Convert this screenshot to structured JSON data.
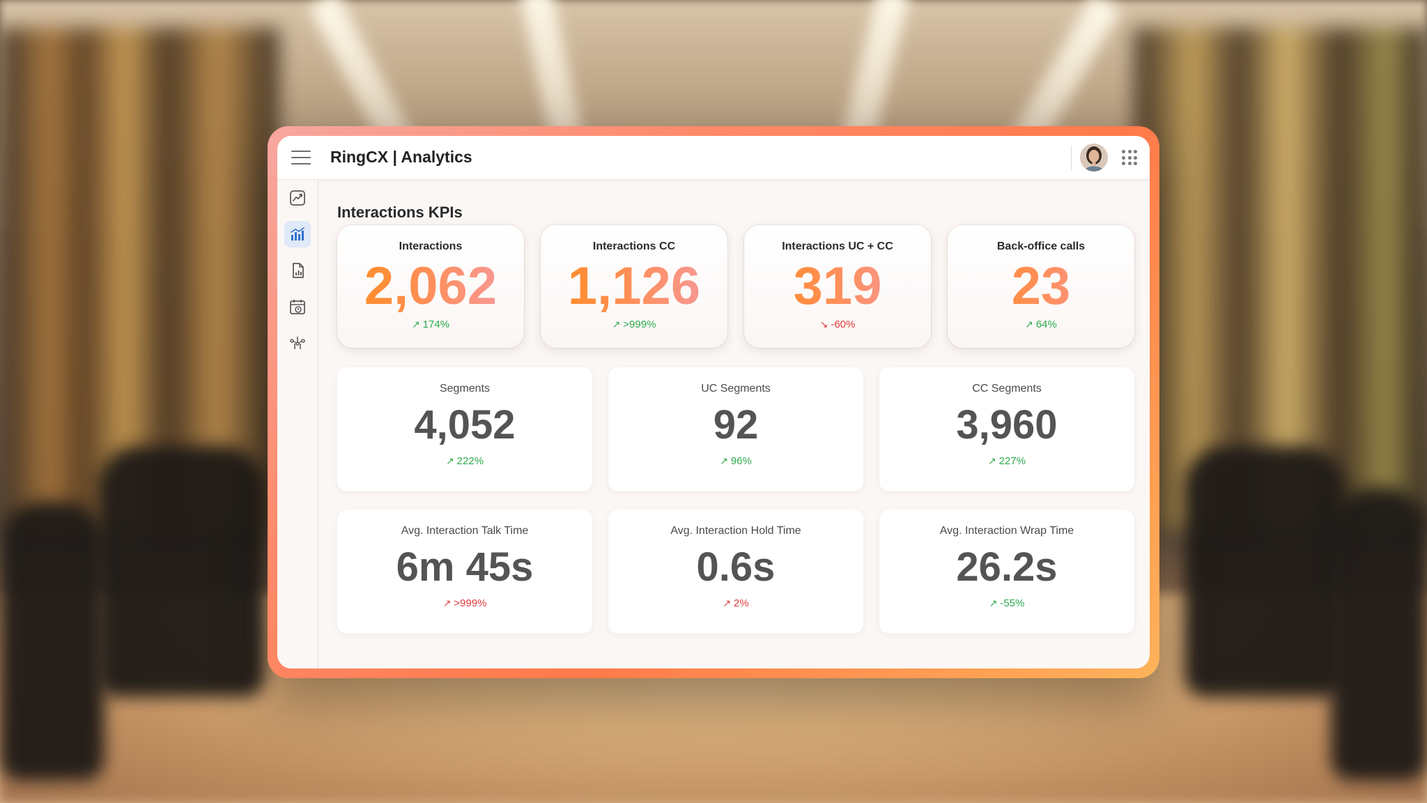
{
  "app": {
    "title": "RingCX | Analytics"
  },
  "page": {
    "section_title": "Interactions KPIs"
  },
  "sidebar": {
    "items": [
      {
        "icon": "trend-chart-icon",
        "active": false
      },
      {
        "icon": "bar-chart-icon",
        "active": true
      },
      {
        "icon": "report-document-icon",
        "active": false
      },
      {
        "icon": "calendar-clock-icon",
        "active": false
      },
      {
        "icon": "flow-nodes-icon",
        "active": false
      }
    ]
  },
  "kpis": [
    {
      "label": "Interactions",
      "value": "2,062",
      "change": "174%",
      "direction": "up"
    },
    {
      "label": "Interactions CC",
      "value": "1,126",
      "change": ">999%",
      "direction": "up"
    },
    {
      "label": "Interactions UC + CC",
      "value": "319",
      "change": "-60%",
      "direction": "down"
    },
    {
      "label": "Back-office calls",
      "value": "23",
      "change": "64%",
      "direction": "up"
    }
  ],
  "segments": [
    {
      "label": "Segments",
      "value": "4,052",
      "change": "222%",
      "direction": "up",
      "color": "#2daa4f"
    },
    {
      "label": "UC Segments",
      "value": "92",
      "change": "96%",
      "direction": "up",
      "color": "#2daa4f"
    },
    {
      "label": "CC Segments",
      "value": "3,960",
      "change": "227%",
      "direction": "up",
      "color": "#2daa4f"
    }
  ],
  "times": [
    {
      "label": "Avg. Interaction Talk Time",
      "value": "6m 45s",
      "change": ">999%",
      "direction": "up",
      "color": "#e23b3b"
    },
    {
      "label": "Avg. Interaction Hold Time",
      "value": "0.6s",
      "change": "2%",
      "direction": "up",
      "color": "#e23b3b"
    },
    {
      "label": "Avg. Interaction Wrap Time",
      "value": "26.2s",
      "change": "-55%",
      "direction": "up",
      "color": "#2daa4f"
    }
  ],
  "colors": {
    "accent": "#ff8c1a",
    "positive": "#2daa4f",
    "negative": "#e23b3b",
    "frame": "#ff7a4a"
  }
}
